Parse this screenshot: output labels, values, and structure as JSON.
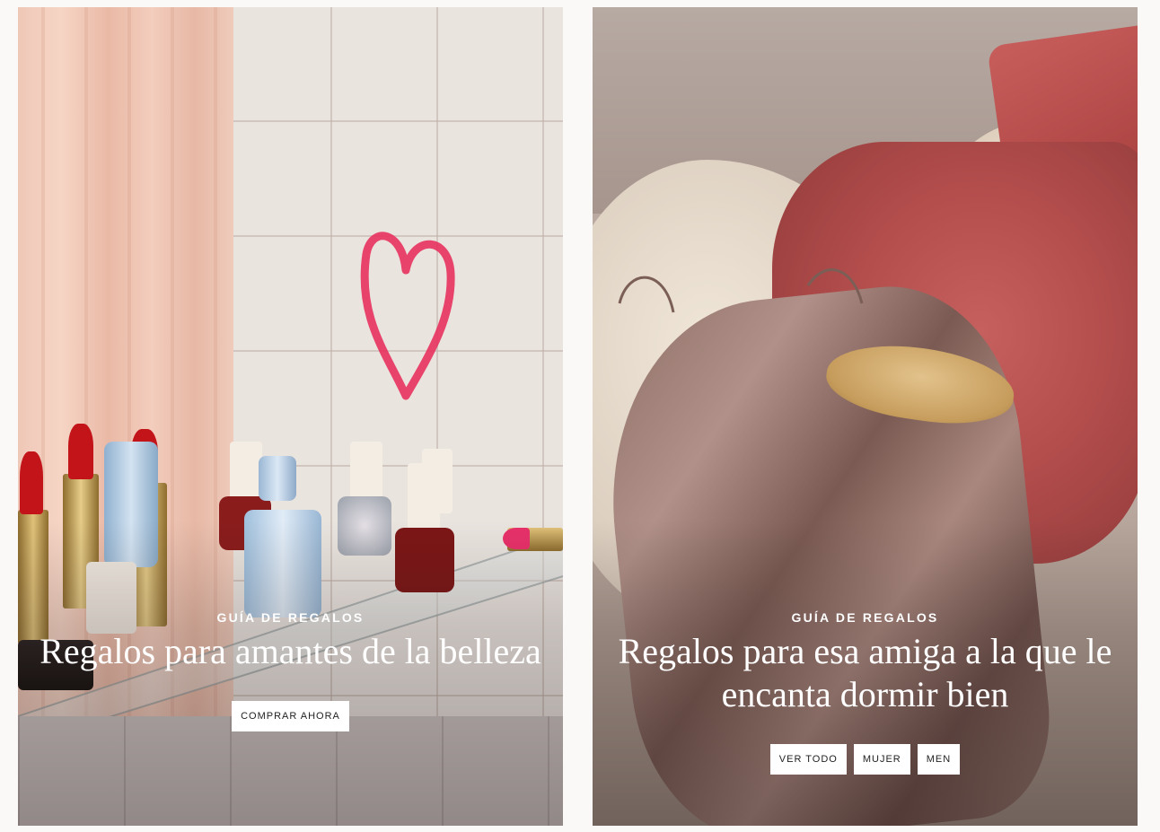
{
  "cards": [
    {
      "eyebrow": "GUÍA DE REGALOS",
      "headline": "Regalos para amantes de la belleza",
      "buttons": [
        "COMPRAR AHORA"
      ]
    },
    {
      "eyebrow": "GUÍA DE REGALOS",
      "headline": "Regalos para esa amiga a la que le encanta dormir bien",
      "buttons": [
        "VER TODO",
        "MUJER",
        "MEN"
      ]
    }
  ],
  "colors": {
    "page_background": "#faf9f8",
    "button_background": "#ffffff",
    "button_text": "#222222",
    "overlay_text": "#ffffff"
  }
}
